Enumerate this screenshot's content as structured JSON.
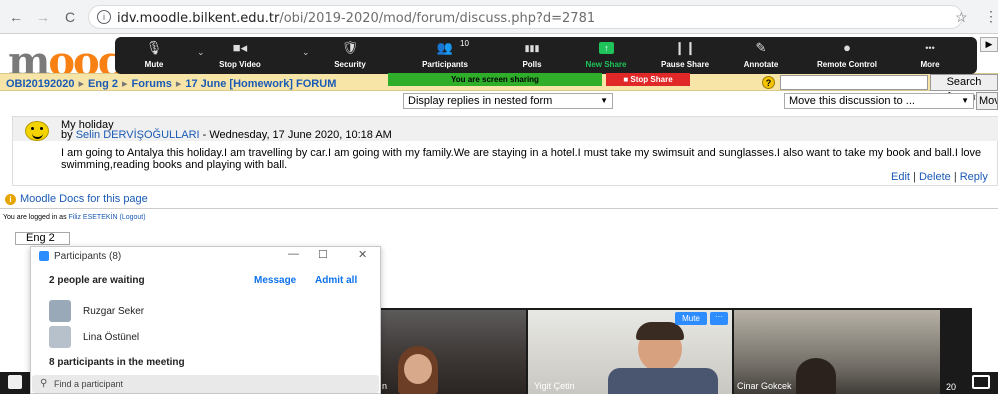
{
  "browser": {
    "url_host": "idv.moodle.bilkent.edu.tr",
    "url_path": "/obi/2019-2020/mod/forum/discuss.php?d=2781",
    "back_icon": "←",
    "forward_icon": "→",
    "reload_icon": "C",
    "info_icon": "i",
    "star_icon": "☆",
    "menu_icon": "⋮"
  },
  "moodle": {
    "logo_text_grey": "m",
    "logo_text_orange": "oo",
    "logo_text_tail": "c",
    "breadcrumb": [
      "OBI20192020",
      "Eng 2",
      "Forums",
      "17 June [Homework] FORUM"
    ],
    "help_icon": "?",
    "search_button": "Search forums",
    "display_mode": "Display replies in nested form",
    "move_discussion": "Move this discussion to ...",
    "move_button": "Move",
    "post": {
      "subject": "My holiday",
      "by": "by",
      "author": "Selin DERVİŞOĞULLARI",
      "date": "- Wednesday, 17 June 2020, 10:18 AM",
      "body": "I am going to Antalya this holiday.I am travelling by car.I am going with my family.We are staying in a hotel.I must take my swimsuit and sunglasses.I also want to take my book and ball.I love swimming,reading books and playing with ball.",
      "actions": [
        "Edit",
        "Delete",
        "Reply"
      ]
    },
    "docs_link": "Moodle Docs for this page",
    "login_prefix": "You are logged in as",
    "login_user": "Filiz ESETEKİN",
    "login_logout": "(Logout)",
    "jump_course": "Eng 2"
  },
  "zoom_toolbar": {
    "items": [
      {
        "icon": "🎙",
        "label": "Mute"
      },
      {
        "icon": "■◂",
        "label": "Stop Video"
      },
      {
        "icon": "🛡",
        "label": "Security"
      },
      {
        "icon": "👥",
        "label": "Participants"
      },
      {
        "icon": "▮▮▮",
        "label": "Polls"
      },
      {
        "icon": "↑",
        "label": "New Share"
      },
      {
        "icon": "❙❙",
        "label": "Pause Share"
      },
      {
        "icon": "✎",
        "label": "Annotate"
      },
      {
        "icon": "●",
        "label": "Remote Control"
      },
      {
        "icon": "•••",
        "label": "More"
      }
    ],
    "participant_count": "10",
    "sharing_text": "You are screen sharing",
    "stop_share_label": "Stop Share",
    "right_tab_icon": "▶",
    "colors": {
      "bar": "#1f1f1f",
      "sharing": "#2fae29",
      "stop": "#e02828",
      "new_share": "#1fc35a"
    }
  },
  "participants_panel": {
    "title": "Participants (8)",
    "minimize": "—",
    "maximize": "☐",
    "close": "✕",
    "waiting_header": "2 people are waiting",
    "message_label": "Message",
    "admit_all_label": "Admit all",
    "waiting": [
      "Ruzgar Seker",
      "Lina Östünel"
    ],
    "in_meeting_header": "8 participants in the meeting",
    "search_icon": "⚲",
    "search_placeholder": "Find a participant"
  },
  "video_strip": {
    "tiles": [
      {
        "name": "n"
      },
      {
        "name": "Yigit Çetin"
      },
      {
        "name": "Cinar Gokcek"
      }
    ],
    "mute_chip": "Mute",
    "more_chip": "···",
    "page_count": "20"
  }
}
